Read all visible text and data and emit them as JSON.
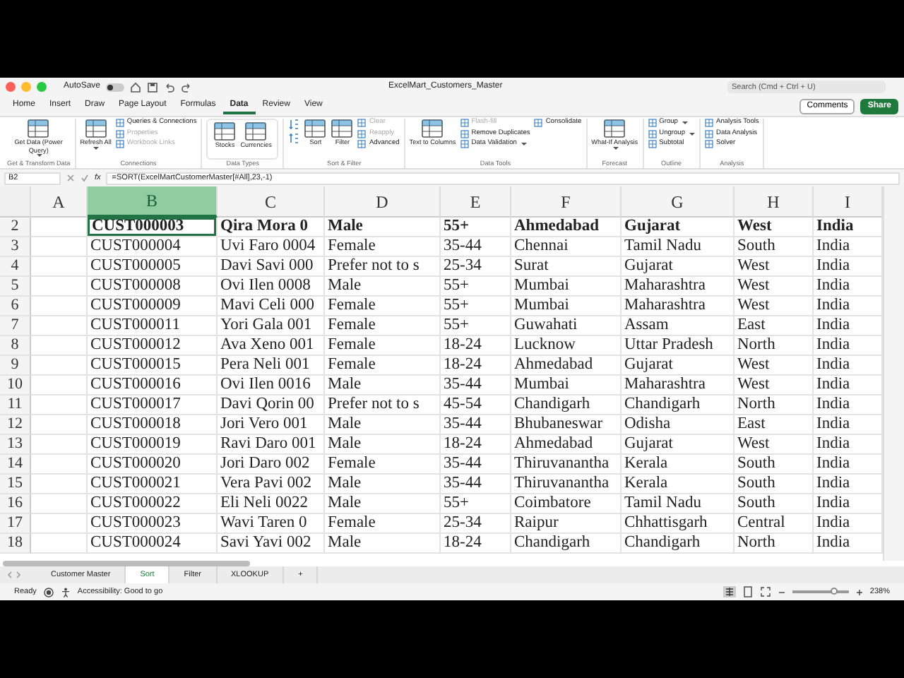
{
  "window": {
    "autosave_label": "AutoSave",
    "autosave_on": false,
    "title": "ExcelMart_Customers_Master",
    "search_placeholder": "Search (Cmd + Ctrl + U)"
  },
  "ribbon_tabs": [
    {
      "label": "Home",
      "selected": false
    },
    {
      "label": "Insert",
      "selected": false
    },
    {
      "label": "Draw",
      "selected": false
    },
    {
      "label": "Page Layout",
      "selected": false
    },
    {
      "label": "Formulas",
      "selected": false
    },
    {
      "label": "Data",
      "selected": true
    },
    {
      "label": "Review",
      "selected": false
    },
    {
      "label": "View",
      "selected": false
    }
  ],
  "comments_button": "Comments",
  "share_button": "Share",
  "ribbon_groups": [
    {
      "label": "Get & Transform Data",
      "boxed": false,
      "items": [
        {
          "kind": "large",
          "label": "Get Data (Power Query)",
          "disabled": false,
          "dropdown": true
        }
      ]
    },
    {
      "label": "Connections",
      "boxed": false,
      "items": [
        {
          "kind": "large",
          "label": "Refresh All",
          "disabled": false,
          "dropdown": true
        },
        {
          "kind": "small",
          "label": "Queries & Connections",
          "disabled": false,
          "dropdown": false
        },
        {
          "kind": "small",
          "label": "Properties",
          "disabled": true,
          "dropdown": false
        },
        {
          "kind": "small",
          "label": "Workbook Links",
          "disabled": true,
          "dropdown": false
        }
      ]
    },
    {
      "label": "Data Types",
      "boxed": true,
      "items": [
        {
          "kind": "large",
          "label": "Stocks",
          "disabled": false,
          "dropdown": false
        },
        {
          "kind": "large",
          "label": "Currencies",
          "disabled": false,
          "dropdown": false
        }
      ]
    },
    {
      "label": "Sort & Filter",
      "boxed": false,
      "items": [
        {
          "kind": "sort",
          "label": "Sort",
          "disabled": false,
          "dropdown": false
        },
        {
          "kind": "large",
          "label": "Filter",
          "disabled": false,
          "dropdown": false
        },
        {
          "kind": "small",
          "label": "Clear",
          "disabled": true,
          "dropdown": false
        },
        {
          "kind": "small",
          "label": "Reapply",
          "disabled": true,
          "dropdown": false
        },
        {
          "kind": "small",
          "label": "Advanced",
          "disabled": false,
          "dropdown": false
        }
      ]
    },
    {
      "label": "Data Tools",
      "boxed": false,
      "items": [
        {
          "kind": "large",
          "label": "Text to Columns",
          "disabled": false,
          "dropdown": false
        },
        {
          "kind": "small",
          "label": "Flash-fill",
          "disabled": true,
          "dropdown": false
        },
        {
          "kind": "small",
          "label": "Remove Duplicates",
          "disabled": false,
          "dropdown": false
        },
        {
          "kind": "small",
          "label": "Data Validation",
          "disabled": false,
          "dropdown": true
        },
        {
          "kind": "small",
          "label": "Consolidate",
          "disabled": false,
          "dropdown": false
        }
      ]
    },
    {
      "label": "Forecast",
      "boxed": false,
      "items": [
        {
          "kind": "large",
          "label": "What-If Analysis",
          "disabled": false,
          "dropdown": true
        }
      ]
    },
    {
      "label": "Outline",
      "boxed": false,
      "items": [
        {
          "kind": "small",
          "label": "Group",
          "disabled": false,
          "dropdown": true
        },
        {
          "kind": "small",
          "label": "Ungroup",
          "disabled": false,
          "dropdown": true
        },
        {
          "kind": "small",
          "label": "Subtotal",
          "disabled": false,
          "dropdown": false
        }
      ]
    },
    {
      "label": "Analysis",
      "boxed": false,
      "items": [
        {
          "kind": "small",
          "label": "Analysis Tools",
          "disabled": false,
          "dropdown": false
        },
        {
          "kind": "small",
          "label": "Data Analysis",
          "disabled": false,
          "dropdown": false
        },
        {
          "kind": "small",
          "label": "Solver",
          "disabled": false,
          "dropdown": false
        }
      ]
    }
  ],
  "formula_bar": {
    "name_box": "B2",
    "function_label": "fx",
    "formula": "=SORT(ExcelMartCustomerMaster[#All],23,-1)"
  },
  "columns": [
    {
      "label": "A",
      "selected": false
    },
    {
      "label": "B",
      "selected": true
    },
    {
      "label": "C",
      "selected": false
    },
    {
      "label": "D",
      "selected": false
    },
    {
      "label": "E",
      "selected": false
    },
    {
      "label": "F",
      "selected": false
    },
    {
      "label": "G",
      "selected": false
    },
    {
      "label": "H",
      "selected": false
    },
    {
      "label": "I",
      "selected": false
    }
  ],
  "rows": [
    {
      "number": "2",
      "bold": true,
      "active": true,
      "cells": [
        "CUST000003",
        "Qira Mora 0",
        "Male",
        "55+",
        "Ahmedabad",
        "Gujarat",
        "West",
        "India"
      ]
    },
    {
      "number": "3",
      "bold": false,
      "active": false,
      "cells": [
        "CUST000004",
        "Uvi Faro 0004",
        "Female",
        "35-44",
        "Chennai",
        "Tamil Nadu",
        "South",
        "India"
      ]
    },
    {
      "number": "4",
      "bold": false,
      "active": false,
      "cells": [
        "CUST000005",
        "Davi Savi 000",
        "Prefer not to s",
        "25-34",
        "Surat",
        "Gujarat",
        "West",
        "India"
      ]
    },
    {
      "number": "5",
      "bold": false,
      "active": false,
      "cells": [
        "CUST000008",
        "Ovi Ilen 0008",
        "Male",
        "55+",
        "Mumbai",
        "Maharashtra",
        "West",
        "India"
      ]
    },
    {
      "number": "6",
      "bold": false,
      "active": false,
      "cells": [
        "CUST000009",
        "Mavi Celi 000",
        "Female",
        "55+",
        "Mumbai",
        "Maharashtra",
        "West",
        "India"
      ]
    },
    {
      "number": "7",
      "bold": false,
      "active": false,
      "cells": [
        "CUST000011",
        "Yori Gala 001",
        "Female",
        "55+",
        "Guwahati",
        "Assam",
        "East",
        "India"
      ]
    },
    {
      "number": "8",
      "bold": false,
      "active": false,
      "cells": [
        "CUST000012",
        "Ava Xeno 001",
        "Female",
        "18-24",
        "Lucknow",
        "Uttar Pradesh",
        "North",
        "India"
      ]
    },
    {
      "number": "9",
      "bold": false,
      "active": false,
      "cells": [
        "CUST000015",
        "Pera Neli 001",
        "Female",
        "18-24",
        "Ahmedabad",
        "Gujarat",
        "West",
        "India"
      ]
    },
    {
      "number": "10",
      "bold": false,
      "active": false,
      "cells": [
        "CUST000016",
        "Ovi Ilen 0016",
        "Male",
        "35-44",
        "Mumbai",
        "Maharashtra",
        "West",
        "India"
      ]
    },
    {
      "number": "11",
      "bold": false,
      "active": false,
      "cells": [
        "CUST000017",
        "Davi Qorin 00",
        "Prefer not to s",
        "45-54",
        "Chandigarh",
        "Chandigarh",
        "North",
        "India"
      ]
    },
    {
      "number": "12",
      "bold": false,
      "active": false,
      "cells": [
        "CUST000018",
        "Jori Vero 001",
        "Male",
        "35-44",
        "Bhubaneswar",
        "Odisha",
        "East",
        "India"
      ]
    },
    {
      "number": "13",
      "bold": false,
      "active": false,
      "cells": [
        "CUST000019",
        "Ravi Daro 001",
        "Male",
        "18-24",
        "Ahmedabad",
        "Gujarat",
        "West",
        "India"
      ]
    },
    {
      "number": "14",
      "bold": false,
      "active": false,
      "cells": [
        "CUST000020",
        "Jori Daro 002",
        "Female",
        "35-44",
        "Thiruvanantha",
        "Kerala",
        "South",
        "India"
      ]
    },
    {
      "number": "15",
      "bold": false,
      "active": false,
      "cells": [
        "CUST000021",
        "Vera Pavi 002",
        "Male",
        "35-44",
        "Thiruvanantha",
        "Kerala",
        "South",
        "India"
      ]
    },
    {
      "number": "16",
      "bold": false,
      "active": false,
      "cells": [
        "CUST000022",
        "Eli Neli 0022",
        "Male",
        "55+",
        "Coimbatore",
        "Tamil Nadu",
        "South",
        "India"
      ]
    },
    {
      "number": "17",
      "bold": false,
      "active": false,
      "cells": [
        "CUST000023",
        "Wavi Taren 0",
        "Female",
        "25-34",
        "Raipur",
        "Chhattisgarh",
        "Central",
        "India"
      ]
    },
    {
      "number": "18",
      "bold": false,
      "active": false,
      "cells": [
        "CUST000024",
        "Savi Yavi 002",
        "Male",
        "18-24",
        "Chandigarh",
        "Chandigarh",
        "North",
        "India"
      ]
    }
  ],
  "sheet_tabs": [
    {
      "label": "Customer Master",
      "selected": false
    },
    {
      "label": "Sort",
      "selected": true
    },
    {
      "label": "Filter",
      "selected": false
    },
    {
      "label": "XLOOKUP",
      "selected": false
    }
  ],
  "add_sheet": "+",
  "status_bar": {
    "ready": "Ready",
    "accessibility": "Accessibility: Good to go",
    "zoom_slider": {
      "level": 0.72
    },
    "zoom": "238%"
  }
}
